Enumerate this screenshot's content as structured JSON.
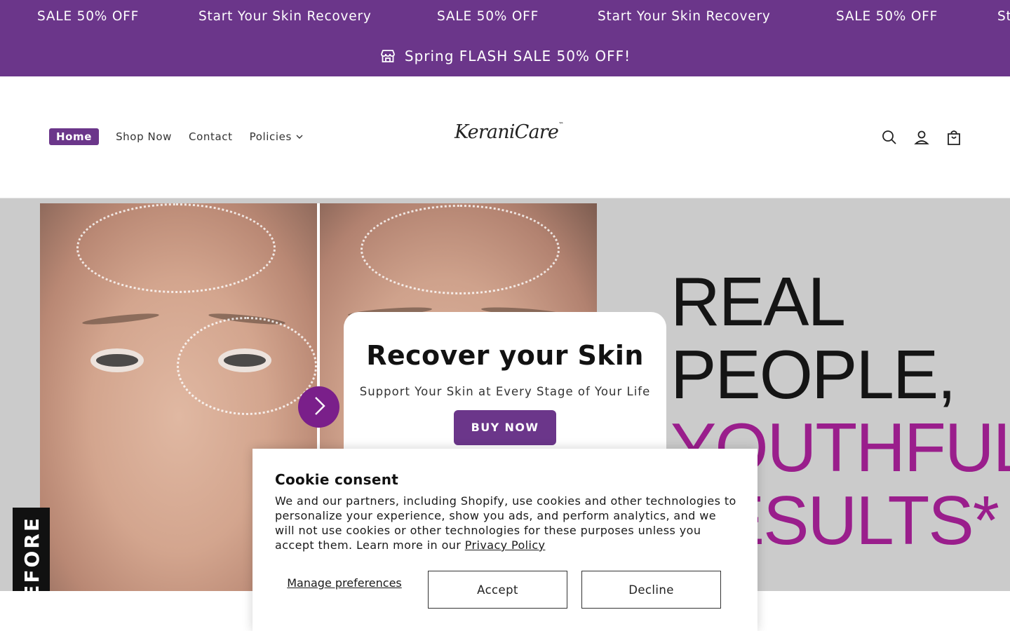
{
  "marquee": {
    "items": [
      "SALE 50% OFF",
      "Start Your Skin Recovery",
      "SALE 50% OFF",
      "Start Your Skin Recovery",
      "SALE 50% OFF",
      "St"
    ]
  },
  "announcement": {
    "icon": "store-icon",
    "text": "Spring FLASH SALE 50% OFF!"
  },
  "nav": {
    "items": [
      {
        "label": "Home",
        "active": true
      },
      {
        "label": "Shop Now"
      },
      {
        "label": "Contact"
      },
      {
        "label": "Policies",
        "icon": "chevron-down-icon"
      }
    ]
  },
  "logo": {
    "text": "KeraniCare",
    "tm": "™"
  },
  "header_icons": [
    "search-icon",
    "account-icon",
    "cart-icon"
  ],
  "hero": {
    "before_label": "BEFORE",
    "slogan": {
      "line1": "REAL",
      "line2": "PEOPLE,",
      "line3": "YOUTHFUL",
      "line4": "RESULTS*"
    },
    "title": "Recover your Skin",
    "subtitle": "Support Your Skin at Every Stage of Your Life",
    "cta": "BUY NOW",
    "next_icon": "chevron-right-icon"
  },
  "cookie": {
    "title": "Cookie consent",
    "body": "We and our partners, including Shopify, use cookies and other technologies to personalize your experience, show you ads, and perform analytics, and we will not use cookies or other technologies for these purposes unless you accept them. Learn more in our ",
    "privacy_link": "Privacy Policy",
    "manage": "Manage preferences",
    "accept": "Accept",
    "decline": "Decline"
  },
  "colors": {
    "brand_purple": "#6b368a",
    "slogan_pink": "#9a1e8c",
    "hero_bg": "#cbcbcb"
  }
}
